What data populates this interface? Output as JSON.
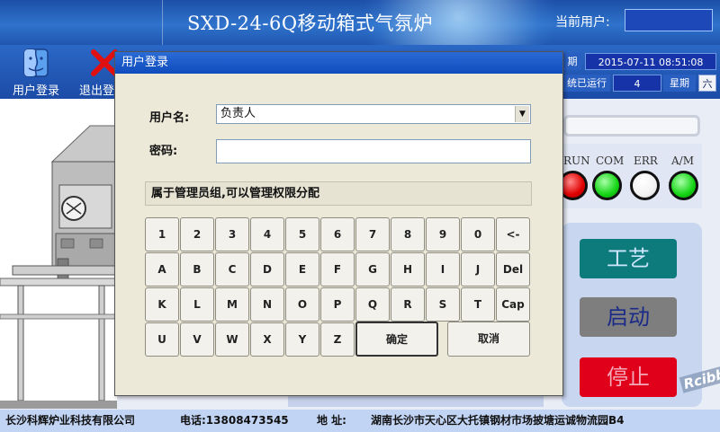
{
  "header": {
    "title": "SXD-24-6Q移动箱式气氛炉",
    "current_user_label": "当前用户:",
    "current_user_value": ""
  },
  "toolbar": {
    "login_label": "用户登录",
    "logout_label": "退出登"
  },
  "status": {
    "date_label": "期",
    "datetime": "2015-07-11 08:51:08",
    "runtime_label": "统已运行",
    "runtime_value": "4",
    "weekday_label": "星期",
    "weekday_value": "六"
  },
  "indicators": [
    "RUN",
    "COM",
    "ERR",
    "A/M"
  ],
  "actions": {
    "process": "工艺",
    "start": "启动",
    "stop": "停止"
  },
  "watermark": "Rcibbs",
  "footer": {
    "company": "长沙科辉炉业科技有限公司",
    "phone": "电话:13808473545",
    "address_label": "地 址:",
    "address": "湖南长沙市天心区大托镇钢材市场披塘运诚物流园B4"
  },
  "dialog": {
    "title": "用户登录",
    "username_label": "用户名:",
    "username_value": "负责人",
    "password_label": "密码:",
    "password_value": "",
    "hint": "属于管理员组,可以管理权限分配",
    "confirm": "确定",
    "cancel": "取消"
  },
  "keypad": {
    "row1": [
      "1",
      "2",
      "3",
      "4",
      "5",
      "6",
      "7",
      "8",
      "9",
      "0",
      "<-"
    ],
    "row2": [
      "A",
      "B",
      "C",
      "D",
      "E",
      "F",
      "G",
      "H",
      "I",
      "J",
      "Del"
    ],
    "row3": [
      "K",
      "L",
      "M",
      "N",
      "O",
      "P",
      "Q",
      "R",
      "S",
      "T",
      "Cap"
    ],
    "row4": [
      "U",
      "V",
      "W",
      "X",
      "Y",
      "Z"
    ]
  }
}
